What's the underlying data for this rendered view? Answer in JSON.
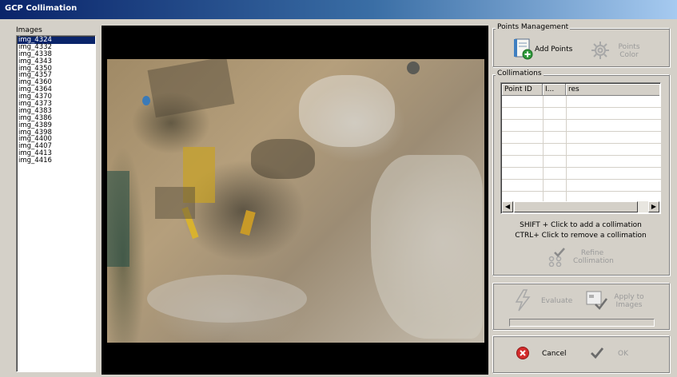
{
  "window": {
    "title": "GCP Collimation"
  },
  "images_panel": {
    "label": "Images",
    "items": [
      "img_4324",
      "img_4332",
      "img_4338",
      "img_4343",
      "img_4350",
      "img_4357",
      "img_4360",
      "img_4364",
      "img_4370",
      "img_4373",
      "img_4383",
      "img_4386",
      "img_4389",
      "img_4398",
      "img_4400",
      "img_4407",
      "img_4413",
      "img_4416"
    ],
    "selected": "img_4324"
  },
  "points_management": {
    "title": "Points Management",
    "add_points": "Add Points",
    "points_color": "Points Color"
  },
  "collimations": {
    "title": "Collimations",
    "columns": [
      "Point ID",
      "I...",
      "res"
    ],
    "hint_add": "SHIFT + Click to add a collimation",
    "hint_remove": "CTRL+ Click to remove a collimation",
    "refine": "Refine Collimation"
  },
  "evaluation": {
    "evaluate": "Evaluate",
    "apply": "Apply to Images",
    "progress": 0
  },
  "footer": {
    "cancel": "Cancel",
    "ok": "OK"
  },
  "icons": {
    "add_points": "add-points-icon",
    "points_color": "gear-icon",
    "refine": "refine-collimation-icon",
    "evaluate": "lightning-icon",
    "apply": "apply-images-icon",
    "cancel": "cancel-icon",
    "ok": "check-icon"
  },
  "colors": {
    "selection": "#0a246a",
    "cancel_red": "#d32b2b",
    "face": "#d4d0c8"
  }
}
